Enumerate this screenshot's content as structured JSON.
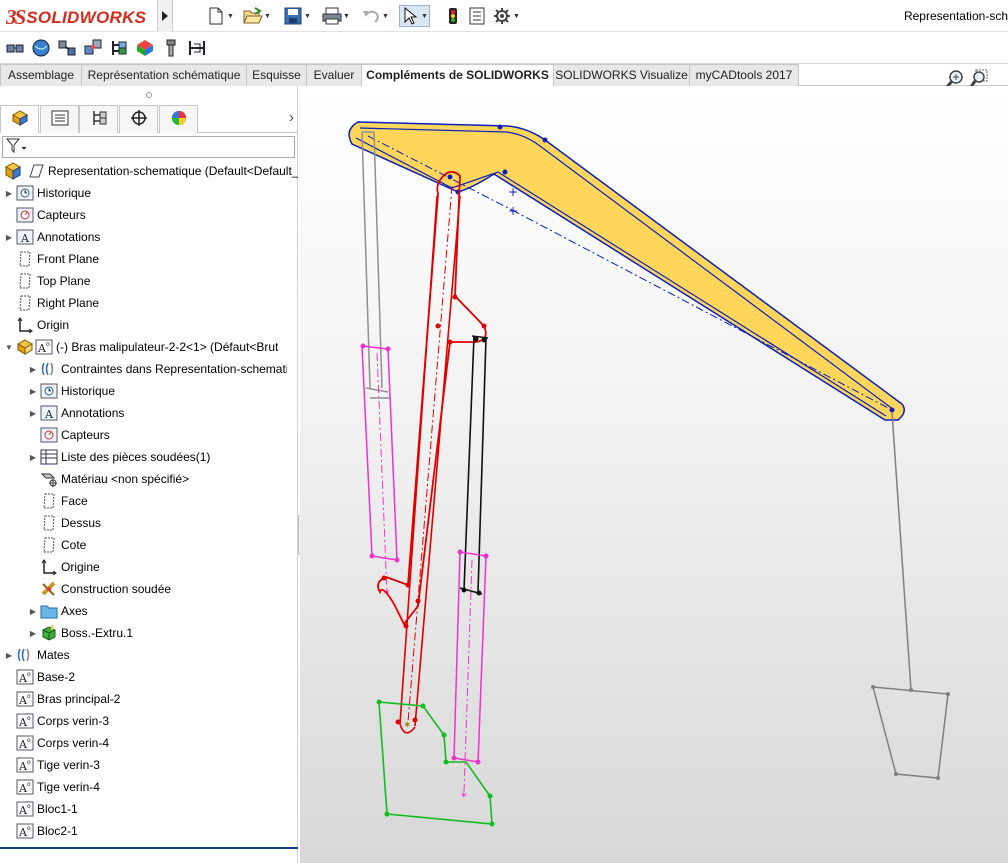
{
  "app": {
    "logo_mark": "3S",
    "logo_text": "SOLIDWORKS",
    "document_title": "Representation-sch"
  },
  "toolbar": {
    "icons": [
      "new-document-icon",
      "open-icon",
      "save-icon",
      "print-icon",
      "undo-icon",
      "select-icon",
      "rebuild-icon",
      "file-properties-icon",
      "options-icon"
    ]
  },
  "command_tabs": [
    {
      "label": "Assemblage",
      "active": false
    },
    {
      "label": "Représentation schématique",
      "active": false
    },
    {
      "label": "Esquisse",
      "active": false
    },
    {
      "label": "Evaluer",
      "active": false
    },
    {
      "label": "Compléments de SOLIDWORKS",
      "active": true
    },
    {
      "label": "SOLIDWORKS Visualize",
      "active": false
    },
    {
      "label": "myCADtools 2017",
      "active": false
    }
  ],
  "feature_tree": {
    "root": "Representation-schematique  (Default<Default_",
    "items": [
      {
        "label": "Historique",
        "icon": "history-icon",
        "expandable": true
      },
      {
        "label": "Capteurs",
        "icon": "sensor-icon",
        "expandable": false
      },
      {
        "label": "Annotations",
        "icon": "annotation-icon",
        "expandable": true
      },
      {
        "label": "Front Plane",
        "icon": "plane-icon",
        "expandable": false
      },
      {
        "label": "Top Plane",
        "icon": "plane-icon",
        "expandable": false
      },
      {
        "label": "Right Plane",
        "icon": "plane-icon",
        "expandable": false
      },
      {
        "label": "Origin",
        "icon": "origin-icon",
        "expandable": false
      },
      {
        "label": "(-) Bras malipulateur-2-2<1> (Défaut<Brut",
        "icon": "part-icon",
        "expandable": true,
        "expanded": true
      },
      {
        "label": "Contraintes dans Representation-schemati",
        "icon": "mates-icon",
        "expandable": true
      },
      {
        "label": "Historique",
        "icon": "history-icon",
        "expandable": true
      },
      {
        "label": "Annotations",
        "icon": "annotation-icon",
        "expandable": true
      },
      {
        "label": "Capteurs",
        "icon": "sensor-icon",
        "expandable": false
      },
      {
        "label": "Liste des pièces soudées(1)",
        "icon": "cutlist-icon",
        "expandable": true
      },
      {
        "label": "Matériau <non spécifié>",
        "icon": "material-icon",
        "expandable": false
      },
      {
        "label": "Face",
        "icon": "plane-icon",
        "expandable": false
      },
      {
        "label": "Dessus",
        "icon": "plane-icon",
        "expandable": false
      },
      {
        "label": "Cote",
        "icon": "plane-icon",
        "expandable": false
      },
      {
        "label": "Origine",
        "icon": "origin-icon",
        "expandable": false
      },
      {
        "label": "Construction soudée",
        "icon": "weldment-icon",
        "expandable": false
      },
      {
        "label": "Axes",
        "icon": "folder-icon",
        "expandable": true
      },
      {
        "label": "Boss.-Extru.1",
        "icon": "extrude-icon",
        "expandable": true
      },
      {
        "label": "Mates",
        "icon": "mates-icon",
        "expandable": true
      },
      {
        "label": "Base-2",
        "icon": "sketch-icon",
        "expandable": false
      },
      {
        "label": "Bras principal-2",
        "icon": "sketch-icon",
        "expandable": false
      },
      {
        "label": "Corps verin-3",
        "icon": "sketch-icon",
        "expandable": false
      },
      {
        "label": "Corps verin-4",
        "icon": "sketch-icon",
        "expandable": false
      },
      {
        "label": "Tige verin-3",
        "icon": "sketch-icon",
        "expandable": false
      },
      {
        "label": "Tige verin-4",
        "icon": "sketch-icon",
        "expandable": false
      },
      {
        "label": "Bloc1-1",
        "icon": "sketch-icon",
        "expandable": false
      },
      {
        "label": "Bloc2-1",
        "icon": "sketch-icon",
        "expandable": false
      }
    ]
  },
  "colors": {
    "boom_fill": "#ffd65a",
    "boom_edge": "#0a1fbf",
    "main_arm": "#e00000",
    "cylinder_body": "#ee33cc",
    "cylinder_rod_grey": "#909090",
    "cylinder_rod_black": "#111111",
    "base": "#11bb22",
    "bucket": "#808080"
  }
}
